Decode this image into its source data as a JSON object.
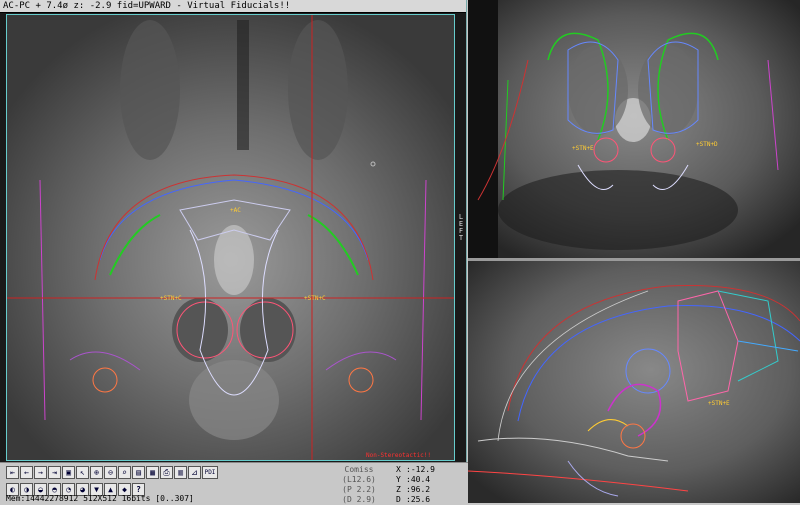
{
  "axial": {
    "header": "AC-PC + 7.4ø z: -2.9  fid=UPWARD - Virtual Fiducials!!",
    "side_label": "LEFT",
    "stn_left": "+STN+C",
    "stn_right": "+STN+C",
    "ac_label": "+AC",
    "nonstereo": "Non-Stereotactic!!"
  },
  "coronal": {
    "stn_left": "+STN+E",
    "stn_right": "+STN+D"
  },
  "sagittal": {
    "stn": "+STN+E"
  },
  "toolbar": {
    "icons": [
      "arrow-left-end-icon",
      "arrow-left-icon",
      "arrow-right-icon",
      "arrow-right-end-icon",
      "window-icon",
      "pointer-icon",
      "zoom-in-icon",
      "zoom-out-icon",
      "magnify-icon",
      "layers-icon",
      "grid-icon",
      "print-icon",
      "film-icon",
      "ruler-icon",
      "pdf-icon"
    ],
    "row2_icons": [
      "orient-1-icon",
      "orient-2-icon",
      "orient-3-icon",
      "orient-4-icon",
      "orient-5-icon",
      "orient-6-icon",
      "orient-7-icon",
      "orient-8-icon",
      "orient-9-icon",
      "help-icon"
    ],
    "help_label": "?",
    "pdf_label": "PDI"
  },
  "status": {
    "memory": "Mem:14442278912  512X512 16bits [0..307]",
    "comiss_title": "Comiss",
    "comiss_l": "(L12.6)",
    "comiss_p": "(P 2.2)",
    "comiss_d": "(D 2.9)",
    "x_label": "X",
    "x_value": ":-12.9",
    "y_label": "Y",
    "y_value": ":40.4",
    "z_label": "Z",
    "z_value": ":96.2",
    "d_label": "D",
    "d_value": ":25.6"
  }
}
